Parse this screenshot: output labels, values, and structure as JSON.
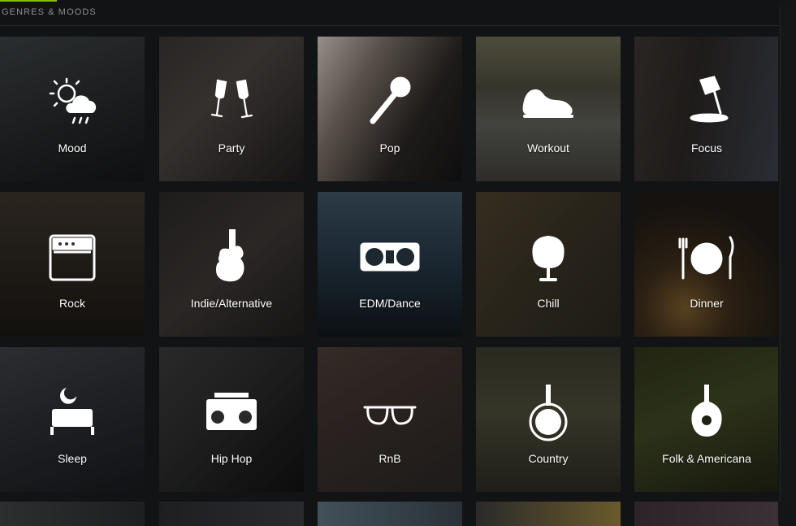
{
  "section": {
    "title": "GENRES & MOODS"
  },
  "tiles": [
    {
      "label": "Mood",
      "icon": "weather-mood-icon"
    },
    {
      "label": "Party",
      "icon": "champagne-glasses-icon"
    },
    {
      "label": "Pop",
      "icon": "microphone-icon"
    },
    {
      "label": "Workout",
      "icon": "sneaker-icon"
    },
    {
      "label": "Focus",
      "icon": "desk-lamp-icon"
    },
    {
      "label": "Rock",
      "icon": "amplifier-icon"
    },
    {
      "label": "Indie/Alternative",
      "icon": "electric-guitar-icon"
    },
    {
      "label": "EDM/Dance",
      "icon": "dj-turntables-icon"
    },
    {
      "label": "Chill",
      "icon": "egg-chair-icon"
    },
    {
      "label": "Dinner",
      "icon": "plate-cutlery-icon"
    },
    {
      "label": "Sleep",
      "icon": "bed-moon-icon"
    },
    {
      "label": "Hip Hop",
      "icon": "boombox-icon"
    },
    {
      "label": "RnB",
      "icon": "sunglasses-icon"
    },
    {
      "label": "Country",
      "icon": "banjo-icon"
    },
    {
      "label": "Folk & Americana",
      "icon": "mandolin-icon"
    }
  ],
  "colors": {
    "accent": "#84bd00",
    "background": "#121314"
  }
}
